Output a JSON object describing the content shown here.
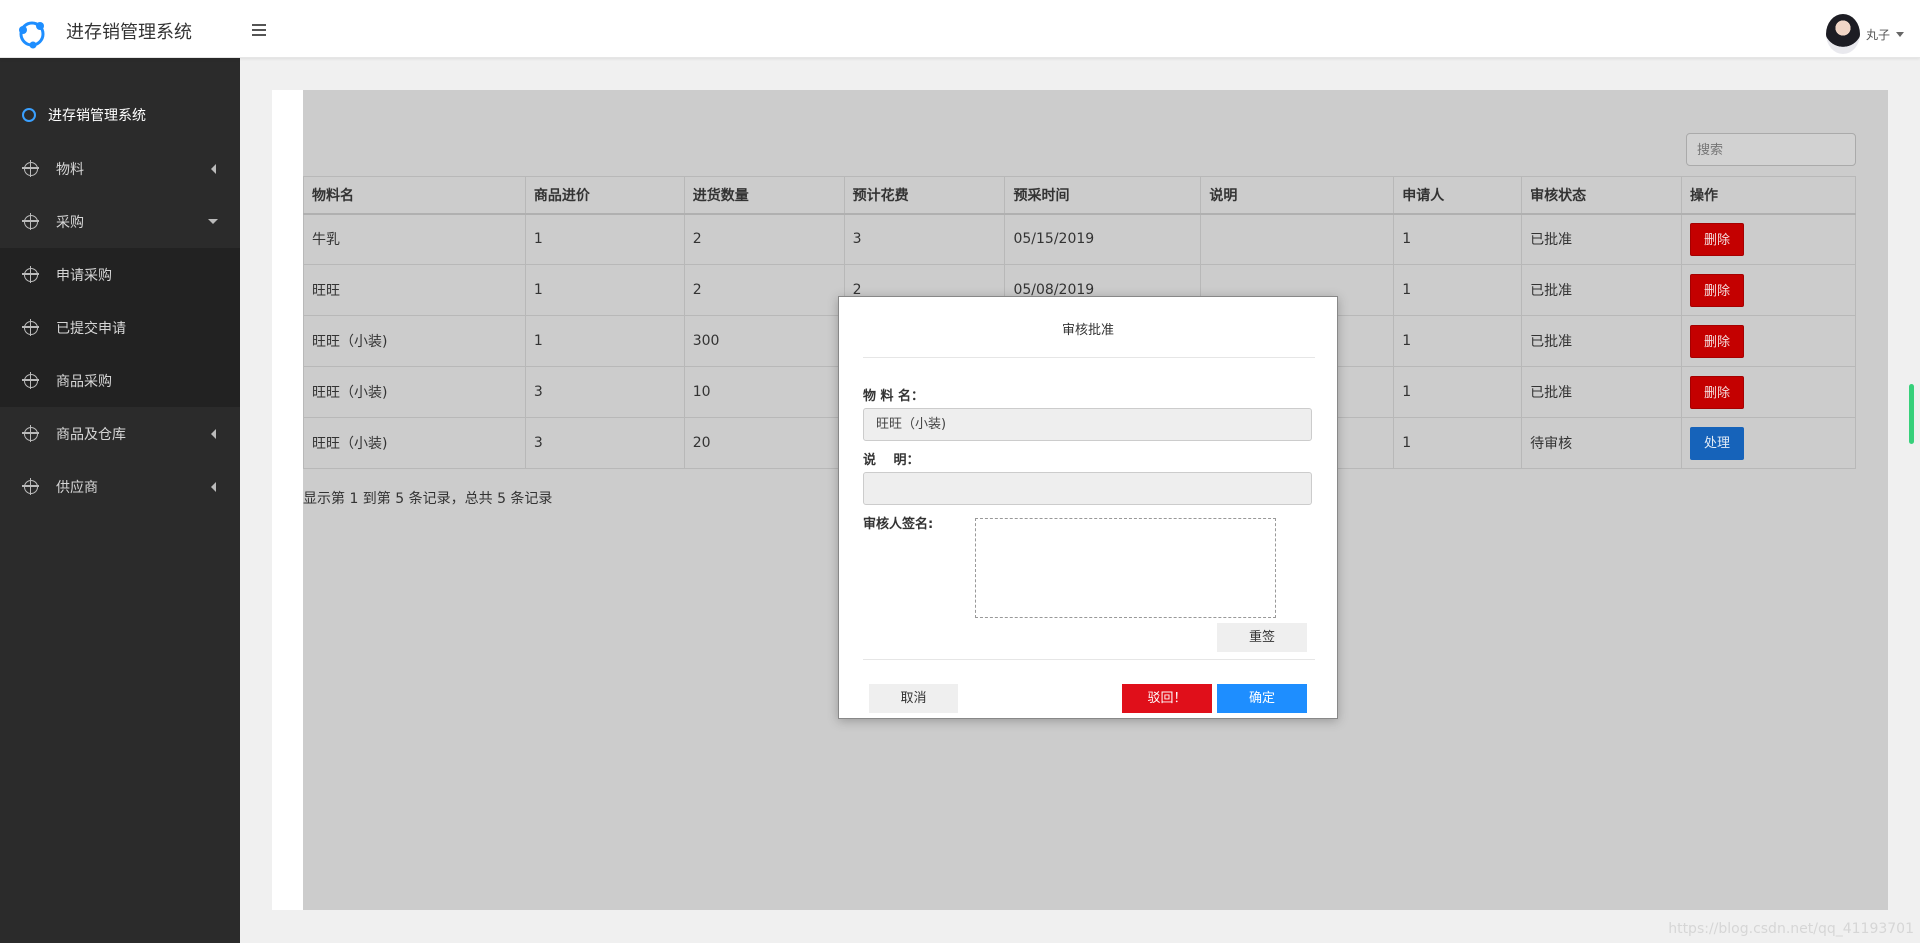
{
  "app": {
    "title": "进存销管理系统"
  },
  "user": {
    "name": "丸子"
  },
  "sidebar": {
    "header": "进存销管理系统",
    "items": [
      {
        "label": "物料"
      },
      {
        "label": "采购"
      },
      {
        "label": "申请采购"
      },
      {
        "label": "已提交申请"
      },
      {
        "label": "商品采购"
      },
      {
        "label": "商品及仓库"
      },
      {
        "label": "供应商"
      }
    ]
  },
  "search": {
    "placeholder": "搜索"
  },
  "table": {
    "headers": [
      "物料名",
      "商品进价",
      "进货数量",
      "预计花费",
      "预采时间",
      "说明",
      "申请人",
      "审核状态",
      "操作"
    ],
    "rows": [
      {
        "name": "牛乳",
        "price": "1",
        "qty": "2",
        "cost": "3",
        "date": "05/15/2019",
        "note": "",
        "applicant": "1",
        "status": "已批准",
        "action": "删除"
      },
      {
        "name": "旺旺",
        "price": "1",
        "qty": "2",
        "cost": "2",
        "date": "05/08/2019",
        "note": "",
        "applicant": "1",
        "status": "已批准",
        "action": "删除"
      },
      {
        "name": "旺旺（小装)",
        "price": "1",
        "qty": "300",
        "cost": "",
        "date": "",
        "note": "",
        "applicant": "1",
        "status": "已批准",
        "action": "删除"
      },
      {
        "name": "旺旺（小装)",
        "price": "3",
        "qty": "10",
        "cost": "",
        "date": "",
        "note": "",
        "applicant": "1",
        "status": "已批准",
        "action": "删除"
      },
      {
        "name": "旺旺（小装)",
        "price": "3",
        "qty": "20",
        "cost": "",
        "date": "",
        "note": "",
        "applicant": "1",
        "status": "待审核",
        "action": "处理"
      }
    ]
  },
  "pager": {
    "text": "显示第 1 到第 5 条记录，总共 5 条记录"
  },
  "modal": {
    "title": "审核批准",
    "name_label": "物 料 名：",
    "name_value": "旺旺（小装)",
    "note_label": "说　 明：",
    "note_value": "",
    "sign_label": "审核人签名:",
    "reset_label": "重签",
    "cancel_label": "取消",
    "reject_label": "驳回！",
    "confirm_label": "确定"
  },
  "watermark": "https://blog.csdn.net/qq_41193701"
}
